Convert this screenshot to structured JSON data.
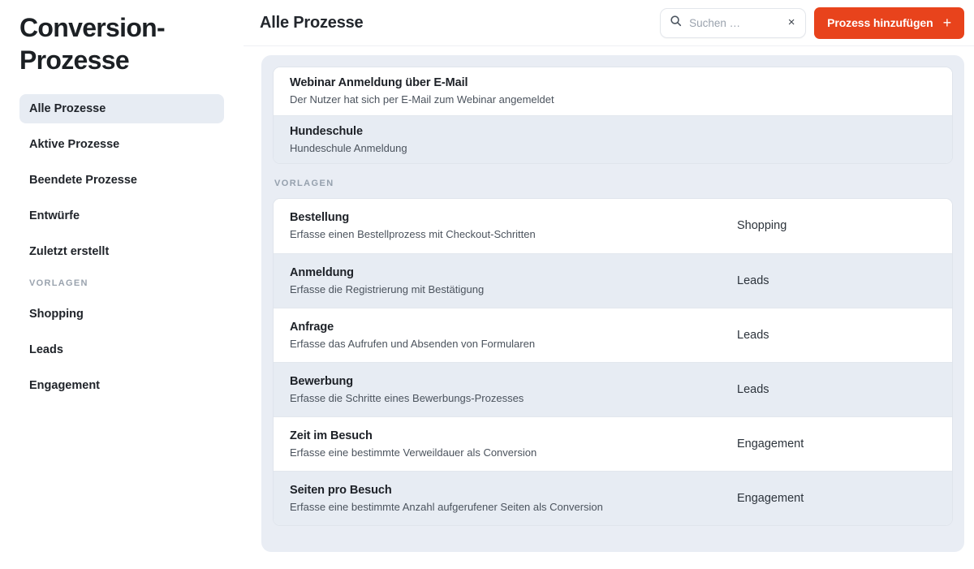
{
  "sidebar": {
    "title": "Conversion-Prozesse",
    "items": [
      {
        "label": "Alle Prozesse",
        "active": true
      },
      {
        "label": "Aktive Prozesse",
        "active": false
      },
      {
        "label": "Beendete Prozesse",
        "active": false
      },
      {
        "label": "Entwürfe",
        "active": false
      },
      {
        "label": "Zuletzt erstellt",
        "active": false
      }
    ],
    "section_label": "VORLAGEN",
    "template_items": [
      {
        "label": "Shopping"
      },
      {
        "label": "Leads"
      },
      {
        "label": "Engagement"
      }
    ]
  },
  "topbar": {
    "page_title": "Alle Prozesse",
    "search": {
      "placeholder": "Suchen …",
      "value": "",
      "icon": "search-icon",
      "clear_icon": "×"
    },
    "add_button": {
      "label": "Prozess hinzufügen",
      "plus_icon": "+",
      "color": "#e8431c"
    }
  },
  "main": {
    "processes": [
      {
        "title": "Webinar Anmeldung über E-Mail",
        "description": "Der Nutzer hat sich per E-Mail zum Webinar angemeldet",
        "category": ""
      },
      {
        "title": "Hundeschule",
        "description": "Hundeschule Anmeldung",
        "category": ""
      }
    ],
    "templates_label": "VORLAGEN",
    "templates": [
      {
        "title": "Bestellung",
        "description": "Erfasse einen Bestellprozess mit Checkout-Schritten",
        "category": "Shopping"
      },
      {
        "title": "Anmeldung",
        "description": "Erfasse die Registrierung mit Bestätigung",
        "category": "Leads"
      },
      {
        "title": "Anfrage",
        "description": "Erfasse das Aufrufen und Absenden von Formularen",
        "category": "Leads"
      },
      {
        "title": "Bewerbung",
        "description": "Erfasse die Schritte eines Bewerbungs-Prozesses",
        "category": "Leads"
      },
      {
        "title": "Zeit im Besuch",
        "description": "Erfasse eine bestimmte Verweildauer als Conversion",
        "category": "Engagement"
      },
      {
        "title": "Seiten pro Besuch",
        "description": "Erfasse eine bestimmte Anzahl aufgerufener Seiten als Conversion",
        "category": "Engagement"
      }
    ]
  },
  "colors": {
    "accent": "#e8431c",
    "panel_bg": "#e9edf4",
    "row_alt_bg": "#e7ecf3",
    "text_primary": "#1d2127",
    "text_secondary": "#4b535d",
    "muted": "#95a0ad"
  }
}
